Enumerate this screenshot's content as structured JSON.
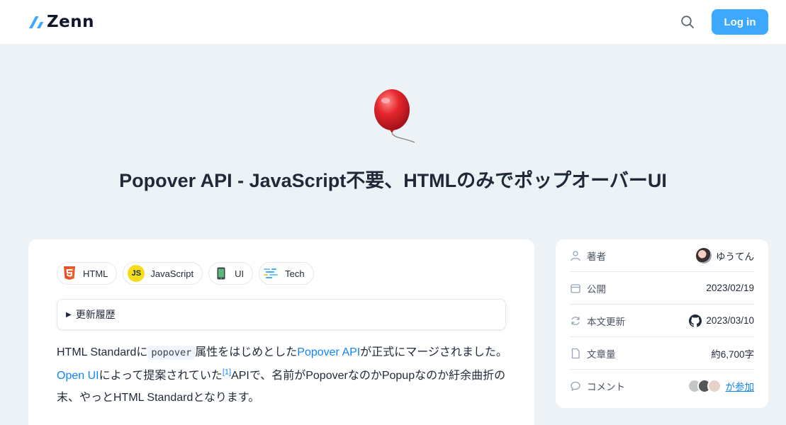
{
  "header": {
    "logo_text": "Zenn",
    "search_icon": "search-icon",
    "login_label": "Log in",
    "accent": "#3ea8ff"
  },
  "article": {
    "emoji": "balloon",
    "title": "Popover API - JavaScript不要、HTMLのみでポップオーバーUI",
    "tags": [
      {
        "label": "HTML",
        "icon": "html5-icon"
      },
      {
        "label": "JavaScript",
        "icon": "js-icon",
        "icon_text": "JS"
      },
      {
        "label": "UI",
        "icon": "phone-icon"
      },
      {
        "label": "Tech",
        "icon": "tech-icon"
      }
    ],
    "details_label": "更新履歴",
    "body": {
      "p1_a": "HTML Standardに",
      "code": "popover",
      "p1_b": "属性をはじめとした",
      "link1": "Popover API",
      "p1_c": "が正式にマージされました。",
      "link2": "Open UI",
      "p1_d": "によって提案されていた",
      "footnote": "[1]",
      "p1_e": "APIで、名前がPopoverなのかPopupなのか紆余曲折の末、やっとHTML Standardとなります。"
    }
  },
  "sidebar": {
    "rows": [
      {
        "label": "著者",
        "value": "ゆうてん",
        "icon": "user-icon"
      },
      {
        "label": "公開",
        "value": "2023/02/19",
        "icon": "calendar-icon"
      },
      {
        "label": "本文更新",
        "value": "2023/03/10",
        "icon": "refresh-icon"
      },
      {
        "label": "文章量",
        "value": "約6,700字",
        "icon": "document-icon"
      },
      {
        "label": "コメント",
        "value": "が参加",
        "icon": "comment-icon"
      }
    ]
  }
}
